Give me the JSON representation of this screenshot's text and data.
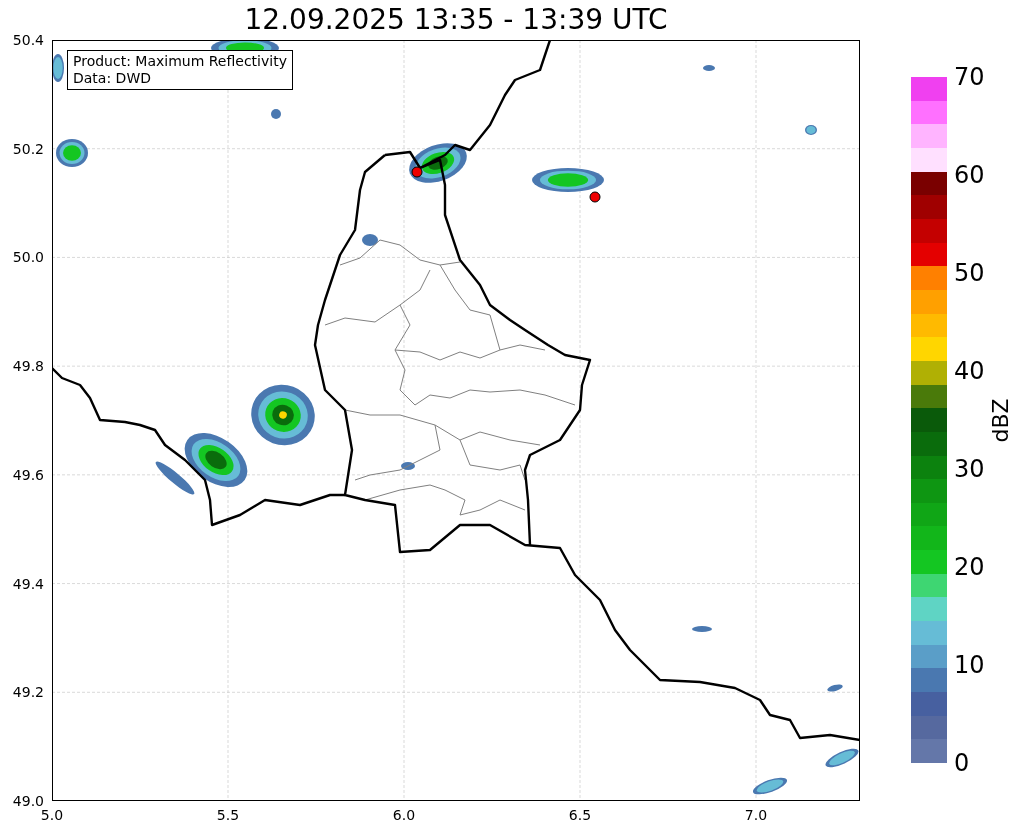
{
  "title": "12.09.2025 13:35 - 13:39 UTC",
  "info_box": {
    "lines": [
      "Product: Maximum Reflectivity",
      "Data: DWD"
    ]
  },
  "map": {
    "x_ticks": [
      "5.0",
      "5.5",
      "6.0",
      "6.5",
      "7.0"
    ],
    "y_ticks": [
      "50.4",
      "50.2",
      "50.0",
      "49.8",
      "49.6",
      "49.4",
      "49.2",
      "49.0"
    ]
  },
  "colorbar": {
    "label": "dBZ",
    "ticks": [
      "70",
      "60",
      "50",
      "40",
      "30",
      "20",
      "10",
      "0"
    ],
    "bands": [
      {
        "color": "#f040f0"
      },
      {
        "color": "#ff70ff"
      },
      {
        "color": "#ffb4ff"
      },
      {
        "color": "#ffe0ff"
      },
      {
        "color": "#7a0000"
      },
      {
        "color": "#a00000"
      },
      {
        "color": "#c40000"
      },
      {
        "color": "#e40000"
      },
      {
        "color": "#ff8000"
      },
      {
        "color": "#ffa000"
      },
      {
        "color": "#ffba00"
      },
      {
        "color": "#ffd600"
      },
      {
        "color": "#b0b004"
      },
      {
        "color": "#4a7a0a"
      },
      {
        "color": "#0a5a0a"
      },
      {
        "color": "#0a6c0c"
      },
      {
        "color": "#0c820e"
      },
      {
        "color": "#0e9612"
      },
      {
        "color": "#10a616"
      },
      {
        "color": "#12b61a"
      },
      {
        "color": "#14c622"
      },
      {
        "color": "#3ed672"
      },
      {
        "color": "#5fd4c4"
      },
      {
        "color": "#66bcd6"
      },
      {
        "color": "#5a9ec8"
      },
      {
        "color": "#4a78b0"
      },
      {
        "color": "#4760a0"
      },
      {
        "color": "#56699f"
      },
      {
        "color": "#6477a9"
      }
    ]
  }
}
